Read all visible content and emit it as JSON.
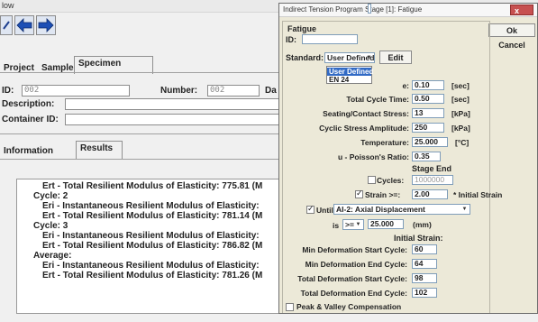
{
  "bg": {
    "title_fragment": "low",
    "tabs": [
      {
        "label": "Project"
      },
      {
        "label": "Sample"
      },
      {
        "label": "Specimen"
      }
    ],
    "id_label": "ID:",
    "id_value": "002",
    "number_label": "Number:",
    "number_value": "002",
    "da_label": "Da",
    "description_label": "Description:",
    "description_value": "",
    "container_label": "Container ID:",
    "container_value": "",
    "sub_tabs": [
      {
        "label": "Information"
      },
      {
        "label": "Results"
      }
    ],
    "results_lines": [
      "Ert - Total Resilient Modulus of Elasticity: 775.81 (M",
      "Cycle: 2",
      "Eri - Instantaneous Resilient Modulus of Elasticity:",
      "Ert - Total Resilient Modulus of Elasticity: 781.14 (M",
      "Cycle: 3",
      "Eri - Instantaneous Resilient Modulus of Elasticity:",
      "Ert - Total Resilient Modulus of Elasticity: 786.82 (M",
      "Average:",
      "Eri - Instantaneous Resilient Modulus of Elasticity:",
      "Ert - Total Resilient Modulus of Elasticity: 781.26 (M"
    ]
  },
  "dialog": {
    "title": "Indirect Tension Program Stage [1]: Fatigue",
    "close_label": "x",
    "ok_label": "Ok",
    "cancel_label": "Cancel",
    "group_label": "Fatigue",
    "id_label": "ID:",
    "id_value": "",
    "standard_label": "Standard:",
    "standard_value": "User Defined",
    "edit_label": "Edit",
    "standard_options": [
      "User Defined",
      "EN 24"
    ],
    "params": [
      {
        "label": "e:",
        "value": "0.10",
        "unit": "[sec]"
      },
      {
        "label": "Total Cycle Time:",
        "value": "0.50",
        "unit": "[sec]"
      },
      {
        "label": "Seating/Contact Stress:",
        "value": "13",
        "unit": "[kPa]"
      },
      {
        "label": "Cyclic Stress Amplitude:",
        "value": "250",
        "unit": "[kPa]"
      },
      {
        "label": "Temperature:",
        "value": "25.000",
        "unit": "[°C]"
      },
      {
        "label": "u - Poisson's Ratio:",
        "value": "0.35",
        "unit": ""
      }
    ],
    "stage_end_label": "Stage End",
    "cycles_label": "Cycles:",
    "cycles_value": "1000000",
    "strain_label": "Strain >=:",
    "strain_value": "2.00",
    "strain_unit": "* Initial Strain",
    "until_label": "Until",
    "until_value": "AI-2: Axial Displacement",
    "is_label": "is",
    "is_op": ">=",
    "is_value": "25.000",
    "is_unit": "(mm)",
    "initial_strain_label": "Initial Strain:",
    "strain_params": [
      {
        "label": "Min Deformation Start Cycle:",
        "value": "60"
      },
      {
        "label": "Min Deformation End Cycle:",
        "value": "64"
      },
      {
        "label": "Total Deformation Start Cycle:",
        "value": "98"
      },
      {
        "label": "Total Deformation End Cycle:",
        "value": "102"
      }
    ],
    "peak_valley_label": "Peak & Valley Compensation"
  }
}
